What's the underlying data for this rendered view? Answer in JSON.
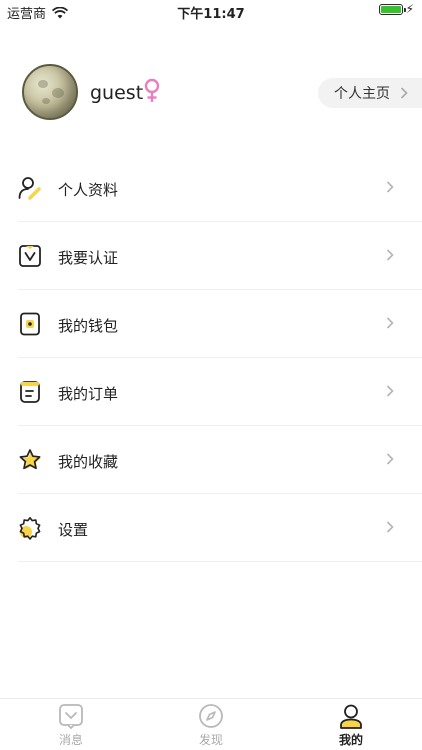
{
  "status_bar": {
    "carrier": "运营商",
    "time": "下午11:47"
  },
  "profile": {
    "username": "guest",
    "homepage_label": "个人主页"
  },
  "menu": [
    {
      "label": "个人资料",
      "icon": "profile-edit-icon"
    },
    {
      "label": "我要认证",
      "icon": "verify-icon"
    },
    {
      "label": "我的钱包",
      "icon": "wallet-icon"
    },
    {
      "label": "我的订单",
      "icon": "order-icon"
    },
    {
      "label": "我的收藏",
      "icon": "star-icon"
    },
    {
      "label": "设置",
      "icon": "gear-icon"
    }
  ],
  "tabbar": [
    {
      "label": "消息",
      "icon": "message-icon",
      "active": false
    },
    {
      "label": "发现",
      "icon": "compass-icon",
      "active": false
    },
    {
      "label": "我的",
      "icon": "user-icon",
      "active": true
    }
  ],
  "colors": {
    "accent": "#f7d44a",
    "gender_female": "#e87fbe",
    "battery": "#3ac12f"
  }
}
